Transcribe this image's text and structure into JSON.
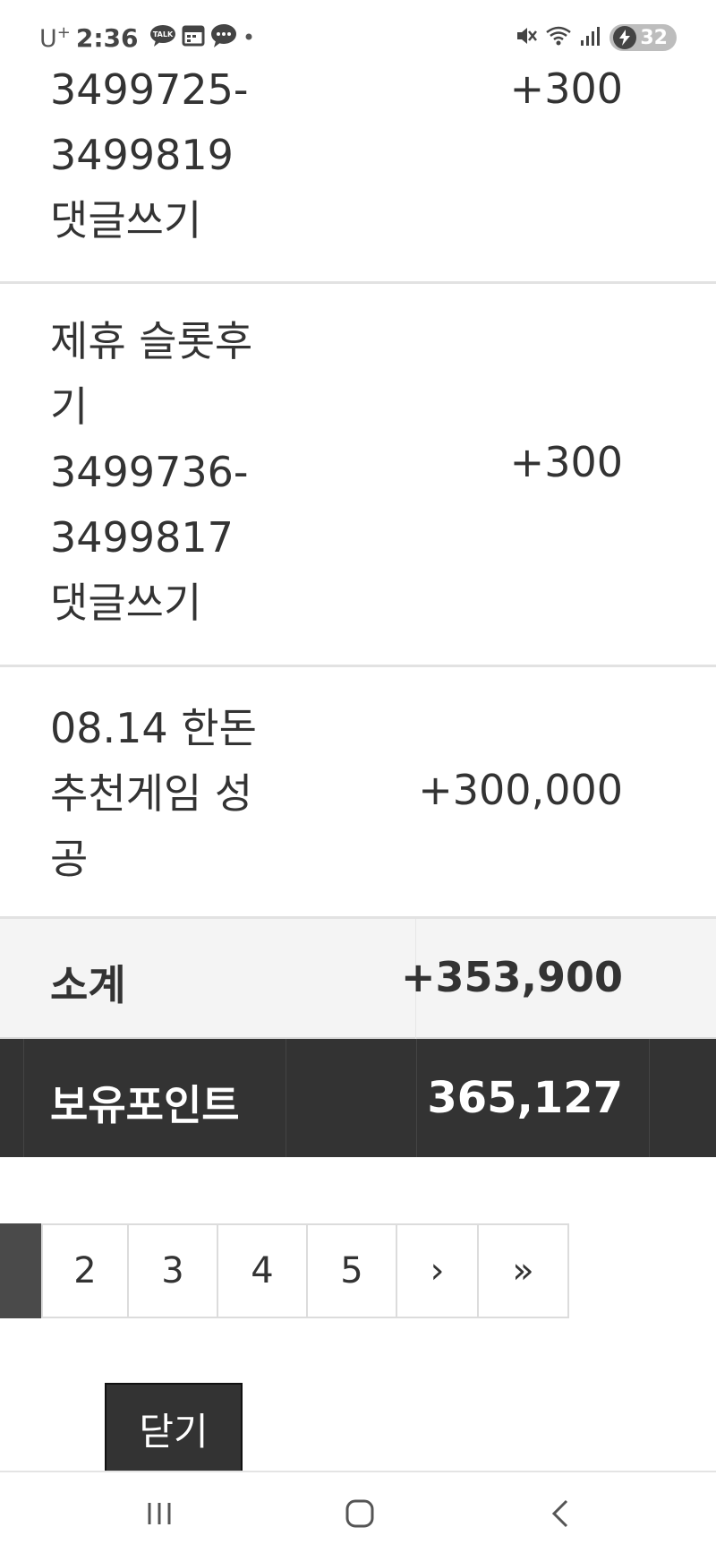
{
  "status_bar": {
    "carrier": "U",
    "carrier_sup": "+",
    "time": "2:36",
    "battery": "32",
    "icons": [
      "talk-icon",
      "calendar-icon",
      "chat-bubble-icon",
      "dot-icon",
      "mute-icon",
      "wifi-icon",
      "signal-icon",
      "battery-charging-icon"
    ]
  },
  "rows": [
    {
      "desc_lines": [
        "3499725-",
        "3499819",
        "댓글쓰기"
      ],
      "points": "+300"
    },
    {
      "desc_lines": [
        "제휴 슬롯후",
        "기",
        "3499736-",
        "3499817",
        "댓글쓰기"
      ],
      "points": "+300"
    },
    {
      "desc_lines": [
        "08.14 한돈",
        "추천게임 성",
        "공"
      ],
      "points": "+300,000"
    }
  ],
  "subtotal": {
    "label": "소계",
    "value": "+353,900"
  },
  "holding": {
    "label": "보유포인트",
    "value": "365,127"
  },
  "pagination": {
    "pages": [
      "2",
      "3",
      "4",
      "5"
    ],
    "next": "›",
    "last": "»"
  },
  "close_button": {
    "label": "닫기"
  },
  "nav": {
    "icons": [
      "recent-apps-icon",
      "home-icon",
      "back-icon"
    ]
  }
}
